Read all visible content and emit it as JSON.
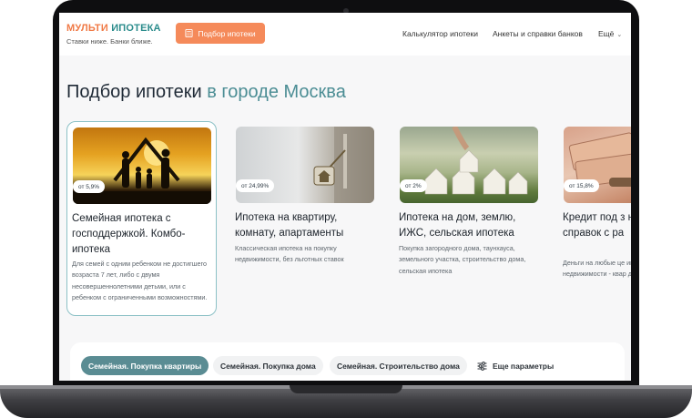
{
  "header": {
    "logo_part1": "МУЛЬТИ",
    "logo_part2": "ИПОТЕКА",
    "tagline": "Ставки ниже. Банки ближе.",
    "pick_button": "Подбор ипотеки",
    "nav": {
      "calculator": "Калькулятор ипотеки",
      "forms": "Анкеты и справки банков",
      "more": "Ещё"
    }
  },
  "main": {
    "title_prefix": "Подбор ипотеки",
    "title_city": "в городе Москва"
  },
  "cards": [
    {
      "rate": "от 5,9%",
      "title": "Семейная ипотека с господдержкой. Комбо-ипотека",
      "desc": "Для семей с одним ребенком не достигшего возраста 7 лет, либо с двумя несовершеннолетними детьми, или с ребенком с ограниченными возможностями."
    },
    {
      "rate": "от 24,99%",
      "title": "Ипотека на квартиру, комнату, апартаменты",
      "desc": "Классическая ипотека на покупку недвижимости, без льготных ставок"
    },
    {
      "rate": "от 2%",
      "title": "Ипотека на дом, землю, ИЖС, сельская ипотека",
      "desc": "Покупка загородного дома, таунхауса, земельного участка, строительство дома, сельская ипотека"
    },
    {
      "rate": "от 15,8%",
      "title": "Кредит под з недвижимост справок с ра",
      "desc": "Деньги на любые це имеющейся в собств недвижимости - квар дом с землей, комме"
    }
  ],
  "filters": {
    "chips": [
      "Семейная. Покупка квартиры",
      "Семейная. Покупка дома",
      "Семейная. Строительство дома"
    ],
    "more": "Еще параметры"
  },
  "colors": {
    "accent_orange": "#f58a5a",
    "accent_teal": "#5a8c93",
    "city_teal": "#4b8d94"
  }
}
